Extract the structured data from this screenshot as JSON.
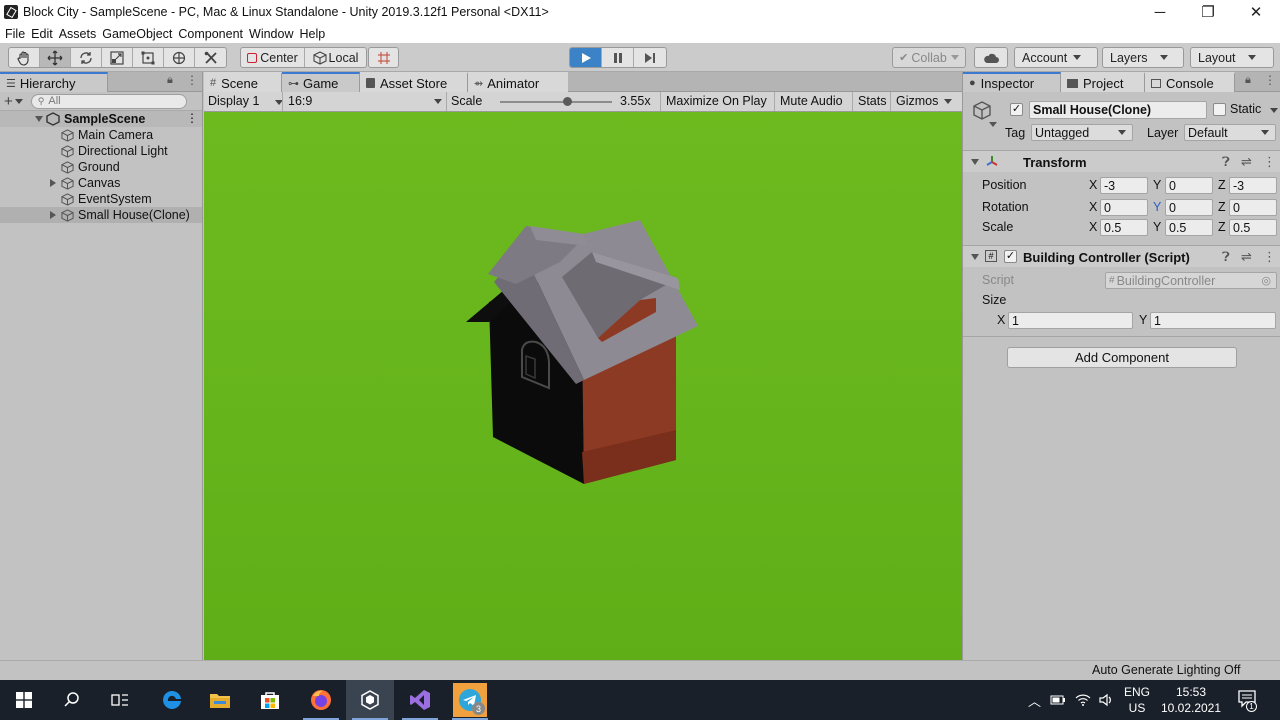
{
  "window": {
    "title": "Block City - SampleScene - PC, Mac & Linux Standalone - Unity 2019.3.12f1 Personal <DX11>",
    "controls": [
      "─",
      "❐",
      "✕"
    ]
  },
  "menu": [
    "File",
    "Edit",
    "Assets",
    "GameObject",
    "Component",
    "Window",
    "Help"
  ],
  "toolbar": {
    "pivot_label": "Center",
    "space_label": "Local",
    "collab_label": "Collab",
    "account_label": "Account",
    "layers_label": "Layers",
    "layout_label": "Layout"
  },
  "hierarchy": {
    "tab_label": "Hierarchy",
    "search_placeholder": "All",
    "scene_name": "SampleScene",
    "items": [
      {
        "label": "Main Camera",
        "expandable": false
      },
      {
        "label": "Directional Light",
        "expandable": false
      },
      {
        "label": "Ground",
        "expandable": false
      },
      {
        "label": "Canvas",
        "expandable": true
      },
      {
        "label": "EventSystem",
        "expandable": false
      },
      {
        "label": "Small House(Clone)",
        "expandable": true
      }
    ]
  },
  "center": {
    "tabs": [
      "Scene",
      "Game",
      "Asset Store",
      "Animator"
    ],
    "active_tab": "Game",
    "display": "Display 1",
    "aspect": "16:9",
    "scale_label": "Scale",
    "scale_value": "3.55x",
    "maximize_label": "Maximize On Play",
    "mute_label": "Mute Audio",
    "stats_label": "Stats",
    "gizmos_label": "Gizmos"
  },
  "inspector": {
    "tabs": [
      "Inspector",
      "Project",
      "Console"
    ],
    "object_name": "Small House(Clone)",
    "static_label": "Static",
    "tag_label": "Tag",
    "tag_value": "Untagged",
    "layer_label": "Layer",
    "layer_value": "Default",
    "transform": {
      "title": "Transform",
      "position_label": "Position",
      "rotation_label": "Rotation",
      "scale_label": "Scale",
      "position": {
        "x": "-3",
        "y": "0",
        "z": "-3"
      },
      "rotation": {
        "x": "0",
        "y": "0",
        "z": "0"
      },
      "scale": {
        "x": "0.5",
        "y": "0.5",
        "z": "0.5"
      }
    },
    "building_controller": {
      "title": "Building Controller (Script)",
      "script_label": "Script",
      "script_value": "BuildingController",
      "size_label": "Size",
      "size_x": "1",
      "size_y": "1"
    },
    "add_component_label": "Add Component",
    "axis_labels": {
      "x": "X",
      "y": "Y",
      "z": "Z"
    }
  },
  "status": {
    "message": "Auto Generate Lighting Off"
  },
  "taskbar": {
    "lang_top": "ENG",
    "lang_bottom": "US",
    "time": "15:53",
    "date": "10.02.2021",
    "notification_count": "1",
    "telegram_badge": "3"
  },
  "colors": {
    "play_button": "#3b82c7",
    "grass": "#66b41c",
    "roof": "#8e8a93",
    "wall_front": "#0c0c0c",
    "wall_side": "#8d3a24",
    "taskbar": "#1a2029"
  }
}
